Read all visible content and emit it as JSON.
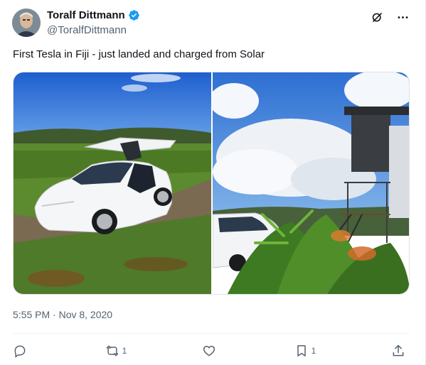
{
  "author": {
    "name": "Toralf Dittmann",
    "handle": "@ToralfDittmann",
    "verified": true,
    "verified_color": "#1d9bf0"
  },
  "header_icons": [
    "grok-icon",
    "more-icon"
  ],
  "tweet": {
    "text": "First Tesla in Fiji - just landed and charged from Solar",
    "timestamp": "5:55 PM · Nov 8, 2020"
  },
  "media": [
    {
      "description_icon": "photo-white-tesla-falcon-doors"
    },
    {
      "description_icon": "photo-tesla-solar-structure-sky"
    }
  ],
  "actions": {
    "reply": {
      "icon": "reply-icon",
      "count": ""
    },
    "retweet": {
      "icon": "retweet-icon",
      "count": "1"
    },
    "like": {
      "icon": "heart-icon",
      "count": ""
    },
    "bookmark": {
      "icon": "bookmark-icon",
      "count": "1"
    },
    "share": {
      "icon": "share-icon",
      "count": ""
    }
  },
  "colors": {
    "text": "#0f1419",
    "secondary": "#536471",
    "divider": "#eff3f4"
  }
}
